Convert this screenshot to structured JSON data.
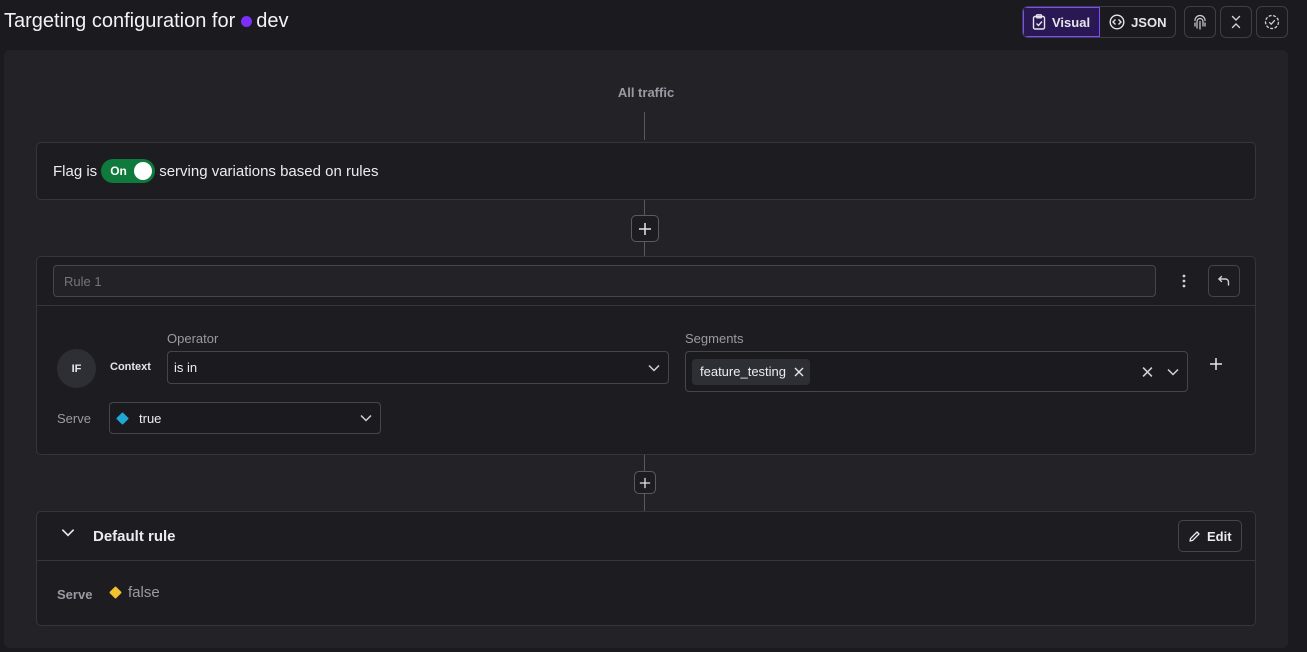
{
  "header": {
    "title": "Targeting configuration for",
    "environment": "dev",
    "environment_color": "#7b2ff7",
    "view_visual_label": "Visual",
    "view_json_label": "JSON",
    "icons": [
      "clipboard-icon",
      "code-icon",
      "fingerprint-icon",
      "collapse-icon",
      "check-circle-icon"
    ]
  },
  "flow": {
    "all_traffic_label": "All traffic"
  },
  "flag_status": {
    "prefix": "Flag is",
    "toggle_label": "On",
    "toggle_on": true,
    "toggle_color": "#0f7a3c",
    "suffix": "serving variations based on rules"
  },
  "rule": {
    "name_placeholder": "Rule 1",
    "if_label": "IF",
    "attribute_label": "Context",
    "operator_label": "Operator",
    "operator_value": "is in",
    "segments_label": "Segments",
    "segments": [
      "feature_testing"
    ],
    "serve_label": "Serve",
    "serve_value": "true",
    "serve_color": "#1fa8d6"
  },
  "default_rule": {
    "title": "Default rule",
    "edit_label": "Edit",
    "serve_label": "Serve",
    "serve_value": "false",
    "serve_color": "#f2c12e"
  }
}
